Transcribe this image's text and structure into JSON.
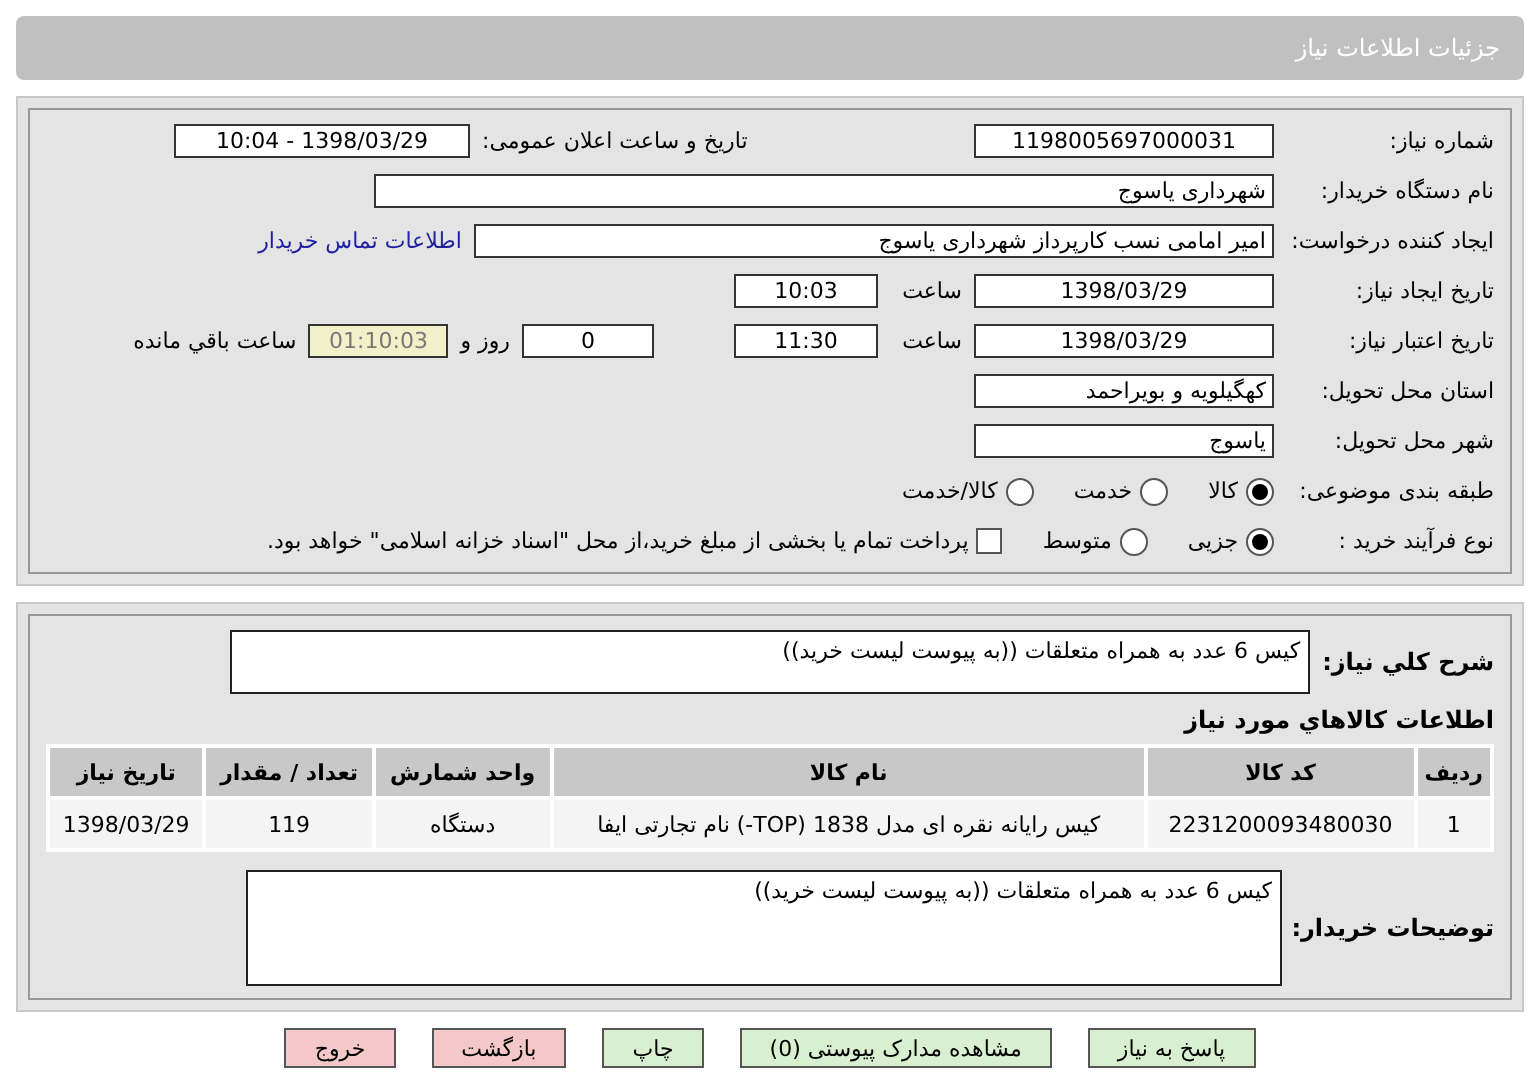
{
  "header": {
    "title": "جزئیات اطلاعات نیاز"
  },
  "details": {
    "need_number": {
      "label": "شماره نیاز:",
      "value": "1198005697000031"
    },
    "announce": {
      "label": "تاریخ و ساعت اعلان عمومی:",
      "value": "1398/03/29 - 10:04"
    },
    "buyer_org": {
      "label": "نام دستگاه خریدار:",
      "value": "شهرداری یاسوج"
    },
    "requester": {
      "label": "ایجاد کننده درخواست:",
      "value": "امیر امامی نسب کارپرداز شهرداری یاسوج",
      "link": "اطلاعات تماس خریدار"
    },
    "created": {
      "label": "تاریخ ایجاد نیاز:",
      "date": "1398/03/29",
      "time_label": "ساعت",
      "time": "10:03"
    },
    "validity": {
      "label": "تاریخ اعتبار نیاز:",
      "date": "1398/03/29",
      "time_label": "ساعت",
      "time": "11:30",
      "days": "0",
      "days_label": "روز و",
      "remaining": "01:10:03",
      "remaining_label": "ساعت باقي مانده"
    },
    "province": {
      "label": "استان محل تحویل:",
      "value": "کهگیلویه و بویراحمد"
    },
    "city": {
      "label": "شهر محل تحویل:",
      "value": "یاسوج"
    },
    "category": {
      "label": "طبقه بندی موضوعی:",
      "options": [
        {
          "label": "کالا",
          "selected": true
        },
        {
          "label": "خدمت",
          "selected": false
        },
        {
          "label": "کالا/خدمت",
          "selected": false
        }
      ]
    },
    "process": {
      "label": "نوع فرآیند خرید :",
      "options": [
        {
          "label": "جزیی",
          "selected": true
        },
        {
          "label": "متوسط",
          "selected": false
        }
      ],
      "treasury": {
        "checked": false,
        "text": "پرداخت تمام یا بخشی از مبلغ خرید،از محل \"اسناد خزانه اسلامی\" خواهد بود."
      }
    }
  },
  "summary": {
    "label": "شرح کلي نیاز:",
    "value": "کیس  6 عدد به همراه متعلقات ((به پیوست لیست خرید))"
  },
  "goods": {
    "title": "اطلاعات کالاهاي مورد نیاز",
    "columns": [
      "ردیف",
      "کد کالا",
      "نام کالا",
      "واحد شمارش",
      "تعداد / مقدار",
      "تاریخ نیاز"
    ],
    "rows": [
      [
        "1",
        "2231200093480030",
        "کیس رایانه نقره ای مدل 1838 (TOP-) نام تجارتی ایفا",
        "دستگاه",
        "119",
        "1398/03/29"
      ]
    ]
  },
  "buyer_notes": {
    "label": "توضیحات خریدار:",
    "value": "کیس  6 عدد به همراه متعلقات ((به پیوست لیست خرید))"
  },
  "buttons": [
    {
      "label": "پاسخ به نیاز",
      "kind": "ok"
    },
    {
      "label": "مشاهده مدارک پیوستی (0)",
      "kind": "ok"
    },
    {
      "label": "چاپ",
      "kind": "ok"
    },
    {
      "label": "بازگشت",
      "kind": "exit"
    },
    {
      "label": "خروج",
      "kind": "exit"
    }
  ]
}
